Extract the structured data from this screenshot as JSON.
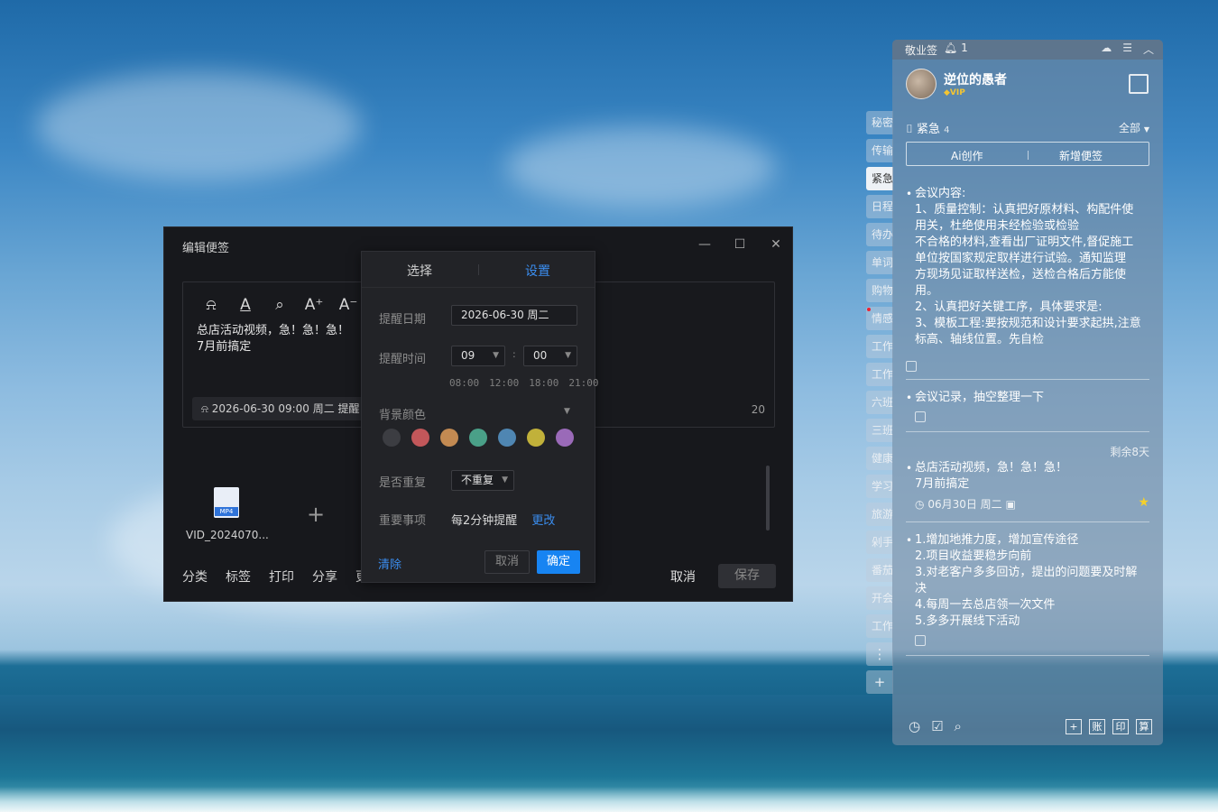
{
  "editor": {
    "title": "编辑便签",
    "window_buttons": [
      "minimize-icon",
      "maximize-icon",
      "close-icon"
    ],
    "toolbar_icons": [
      "bell-icon",
      "font-color-icon",
      "search-icon",
      "font-increase-icon",
      "font-decrease-icon"
    ],
    "note_line1": "总店活动视频，急！急！急！",
    "note_line2": "7月前搞定",
    "reminder_chip": "2026-06-30 09:00 周二 提醒",
    "char_count": "20",
    "attachment_name": "VID_2024070...",
    "attachment_badge": "MP4",
    "bottom_menu": [
      "分类",
      "标签",
      "打印",
      "分享",
      "更"
    ],
    "cancel_label": "取消",
    "save_label": "保存"
  },
  "popup": {
    "tab_select": "选择",
    "tab_settings": "设置",
    "date_label": "提醒日期",
    "date_value": "2026-06-30  周二",
    "time_label": "提醒时间",
    "hour_value": "09",
    "minute_value": "00",
    "time_sep": ":",
    "quick_times": [
      "08:00",
      "12:00",
      "18:00",
      "21:00"
    ],
    "color_label": "背景颜色",
    "colors": [
      "#3c3d42",
      "#c2575a",
      "#c38a52",
      "#4aa088",
      "#4f86b2",
      "#c1b13a",
      "#9a6ab8"
    ],
    "repeat_label": "是否重复",
    "repeat_value": "不重复",
    "important_label": "重要事项",
    "important_value": "每2分钟提醒",
    "change_link": "更改",
    "clear_label": "清除",
    "cancel_label": "取消",
    "ok_label": "确定"
  },
  "side_tabs": [
    "秘密",
    "传输",
    "紧急",
    "日程",
    "待办",
    "单词",
    "购物",
    "情感",
    "工作",
    "工作",
    "六班",
    "三班",
    "健康",
    "学习",
    "旅游",
    "剁手",
    "番茄",
    "开会",
    "工作"
  ],
  "widget": {
    "app_name": "敬业签",
    "bell_count": "1",
    "user_name": "逆位的愚者",
    "vip_label": "VIP",
    "category": "紧急",
    "category_count": "4",
    "filter_all": "全部",
    "ai_button": "Ai创作",
    "new_note_button": "新增便签",
    "notes": [
      {
        "lines": [
          "会议内容:",
          "1、质量控制：认真把好原材料、构配件使",
          "用关，杜绝使用未经检验或检验",
          "不合格的材料,查看出厂证明文件,督促施工",
          "单位按国家规定取样进行试验。通知监理",
          "方现场见证取样送检，送检合格后方能使",
          "用。",
          "2、认真把好关键工序，具体要求是:",
          "3、模板工程:要按规范和设计要求起拱,注意",
          "标高、轴线位置。先自检"
        ]
      },
      {
        "lines": [
          "会议记录，抽空整理一下"
        ]
      },
      {
        "remaining": "剩余8天",
        "lines": [
          "总店活动视频，急！急！急！",
          "7月前搞定"
        ],
        "meta": "06月30日 周二"
      },
      {
        "lines": [
          "1.增加地推力度，增加宣传途径",
          "2.项目收益要稳步向前",
          "3.对老客户多多回访，提出的问题要及时解",
          "决",
          "4.每周一去总店领一次文件",
          "5.多多开展线下活动"
        ]
      }
    ],
    "bottom_right_buttons": [
      "+",
      "账",
      "印",
      "算"
    ]
  }
}
